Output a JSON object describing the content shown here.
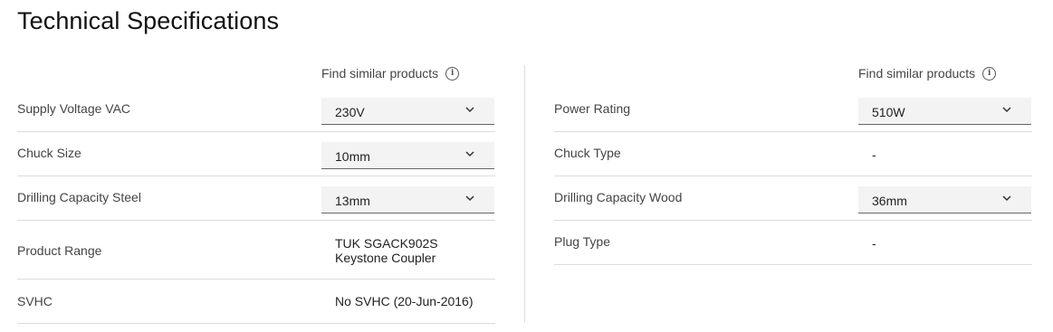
{
  "title": "Technical Specifications",
  "find_similar": "Find similar products",
  "left": [
    {
      "label": "Supply Voltage VAC",
      "value": "230V",
      "type": "select"
    },
    {
      "label": "Chuck Size",
      "value": "10mm",
      "type": "select"
    },
    {
      "label": "Drilling Capacity Steel",
      "value": "13mm",
      "type": "select"
    },
    {
      "label": "Product Range",
      "value": "TUK SGACK902S Keystone Coupler",
      "type": "text"
    },
    {
      "label": "SVHC",
      "value": "No SVHC (20-Jun-2016)",
      "type": "text"
    }
  ],
  "right": [
    {
      "label": "Power Rating",
      "value": "510W",
      "type": "select"
    },
    {
      "label": "Chuck Type",
      "value": "-",
      "type": "text"
    },
    {
      "label": "Drilling Capacity Wood",
      "value": "36mm",
      "type": "select"
    },
    {
      "label": "Plug Type",
      "value": "-",
      "type": "text"
    }
  ]
}
